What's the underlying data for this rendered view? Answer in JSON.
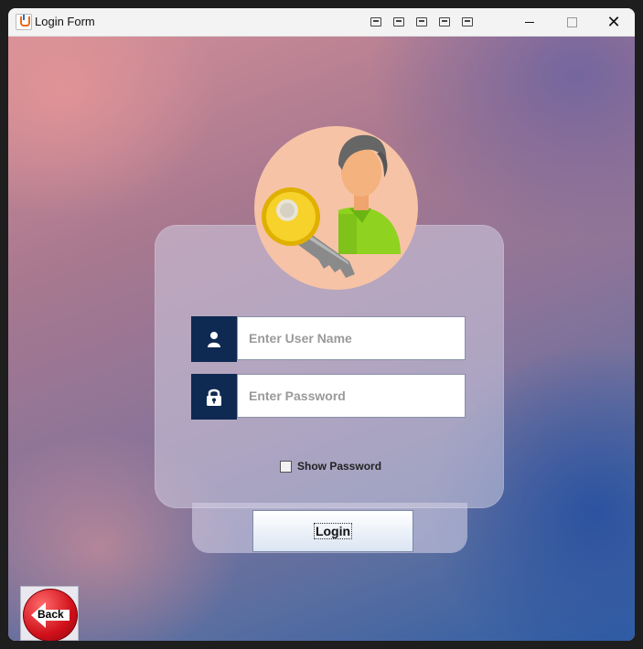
{
  "window": {
    "title": "Login Form",
    "controls": [
      "minimize",
      "maximize",
      "close"
    ]
  },
  "toolbar_icons": [
    "desktop-icon",
    "screen-icon",
    "monitor-icon",
    "printer-icon",
    "network-icon"
  ],
  "form": {
    "username_placeholder": "Enter User Name",
    "password_placeholder": "Enter Password",
    "show_password_label": "Show Password",
    "show_password_checked": false,
    "login_label": "Login",
    "back_label": "Back"
  },
  "colors": {
    "field_icon_bg": "#0f2a52",
    "avatar_bg": "#f6c3a6",
    "back_red": "#d0101a"
  }
}
